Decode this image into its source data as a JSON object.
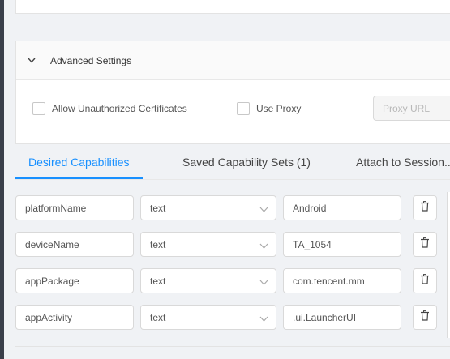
{
  "advanced": {
    "title": "Advanced Settings",
    "allow_unauthorized_label": "Allow Unauthorized Certificates",
    "use_proxy_label": "Use Proxy",
    "proxy_placeholder": "Proxy URL"
  },
  "tabs": [
    {
      "label": "Desired Capabilities",
      "active": true
    },
    {
      "label": "Saved Capability Sets (1)",
      "active": false
    },
    {
      "label": "Attach to Session...",
      "active": false
    }
  ],
  "capabilities": [
    {
      "name": "platformName",
      "type": "text",
      "value": "Android"
    },
    {
      "name": "deviceName",
      "type": "text",
      "value": "TA_1054"
    },
    {
      "name": "appPackage",
      "type": "text",
      "value": "com.tencent.mm"
    },
    {
      "name": "appActivity",
      "type": "text",
      "value": ".ui.LauncherUI"
    }
  ],
  "colors": {
    "accent": "#1890ff",
    "border": "#d9d9d9",
    "background": "#f0f2f5"
  },
  "icons": {
    "collapse": "chevron-down-icon",
    "select": "chevron-down-icon",
    "delete": "trash-icon"
  }
}
